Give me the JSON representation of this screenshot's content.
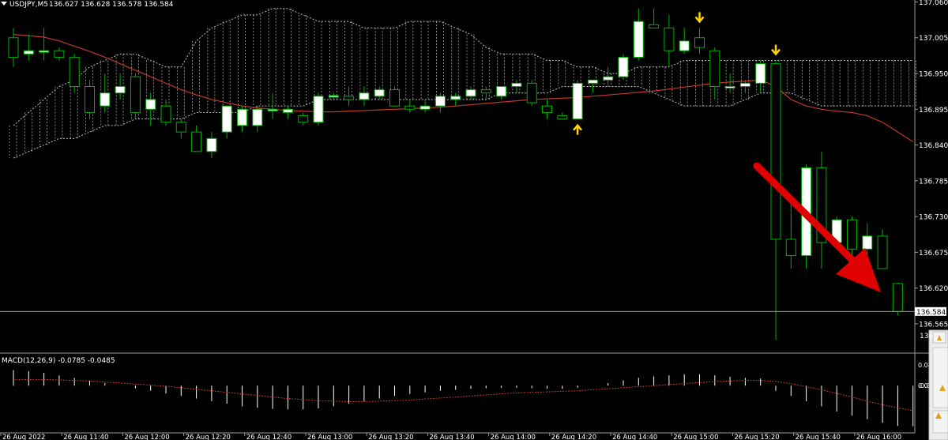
{
  "chart_data": [
    {
      "type": "candlestick",
      "symbol_label": "USDJPY,M5",
      "ohlc_label": "136.627 136.628 136.578 136.584",
      "price_axis_ticks": [
        "137.060",
        "137.005",
        "136.950",
        "136.895",
        "136.840",
        "136.785",
        "136.730",
        "136.675",
        "136.620",
        "136.565"
      ],
      "price_axis_partial_labels": [
        "136",
        "136"
      ],
      "current_price_label": "136.584",
      "current_price": 136.584,
      "ylim": [
        136.52,
        137.063
      ],
      "candles": [
        {
          "o": 137.005,
          "h": 137.02,
          "l": 136.96,
          "c": 136.975
        },
        {
          "o": 136.98,
          "h": 137.01,
          "l": 136.97,
          "c": 136.985
        },
        {
          "o": 136.985,
          "h": 137.02,
          "l": 136.97,
          "c": 136.985
        },
        {
          "o": 136.985,
          "h": 136.99,
          "l": 136.97,
          "c": 136.975
        },
        {
          "o": 136.975,
          "h": 136.98,
          "l": 136.92,
          "c": 136.93
        },
        {
          "o": 136.93,
          "h": 136.94,
          "l": 136.88,
          "c": 136.89
        },
        {
          "o": 136.9,
          "h": 136.95,
          "l": 136.89,
          "c": 136.92
        },
        {
          "o": 136.92,
          "h": 136.95,
          "l": 136.91,
          "c": 136.93
        },
        {
          "o": 136.945,
          "h": 136.95,
          "l": 136.88,
          "c": 136.89
        },
        {
          "o": 136.895,
          "h": 136.92,
          "l": 136.87,
          "c": 136.91
        },
        {
          "o": 136.9,
          "h": 136.91,
          "l": 136.87,
          "c": 136.875
        },
        {
          "o": 136.875,
          "h": 136.88,
          "l": 136.85,
          "c": 136.86
        },
        {
          "o": 136.86,
          "h": 136.87,
          "l": 136.83,
          "c": 136.83
        },
        {
          "o": 136.83,
          "h": 136.86,
          "l": 136.82,
          "c": 136.85
        },
        {
          "o": 136.86,
          "h": 136.9,
          "l": 136.85,
          "c": 136.9
        },
        {
          "o": 136.87,
          "h": 136.9,
          "l": 136.86,
          "c": 136.895
        },
        {
          "o": 136.87,
          "h": 136.9,
          "l": 136.86,
          "c": 136.895
        },
        {
          "o": 136.895,
          "h": 136.92,
          "l": 136.88,
          "c": 136.895
        },
        {
          "o": 136.89,
          "h": 136.9,
          "l": 136.88,
          "c": 136.895
        },
        {
          "o": 136.885,
          "h": 136.89,
          "l": 136.87,
          "c": 136.875
        },
        {
          "o": 136.875,
          "h": 136.92,
          "l": 136.87,
          "c": 136.915
        },
        {
          "o": 136.915,
          "h": 136.92,
          "l": 136.91,
          "c": 136.916
        },
        {
          "o": 136.915,
          "h": 136.93,
          "l": 136.9,
          "c": 136.91
        },
        {
          "o": 136.91,
          "h": 136.93,
          "l": 136.9,
          "c": 136.92
        },
        {
          "o": 136.915,
          "h": 136.93,
          "l": 136.91,
          "c": 136.925
        },
        {
          "o": 136.925,
          "h": 136.93,
          "l": 136.9,
          "c": 136.9
        },
        {
          "o": 136.9,
          "h": 136.91,
          "l": 136.89,
          "c": 136.895
        },
        {
          "o": 136.895,
          "h": 136.91,
          "l": 136.89,
          "c": 136.9
        },
        {
          "o": 136.9,
          "h": 136.92,
          "l": 136.89,
          "c": 136.915
        },
        {
          "o": 136.91,
          "h": 136.92,
          "l": 136.9,
          "c": 136.915
        },
        {
          "o": 136.915,
          "h": 136.93,
          "l": 136.91,
          "c": 136.925
        },
        {
          "o": 136.925,
          "h": 136.93,
          "l": 136.91,
          "c": 136.92
        },
        {
          "o": 136.915,
          "h": 136.93,
          "l": 136.91,
          "c": 136.93
        },
        {
          "o": 136.93,
          "h": 136.94,
          "l": 136.92,
          "c": 136.935
        },
        {
          "o": 136.935,
          "h": 136.94,
          "l": 136.9,
          "c": 136.905
        },
        {
          "o": 136.9,
          "h": 136.91,
          "l": 136.88,
          "c": 136.89
        },
        {
          "o": 136.885,
          "h": 136.89,
          "l": 136.88,
          "c": 136.88
        },
        {
          "o": 136.88,
          "h": 136.94,
          "l": 136.88,
          "c": 136.935
        },
        {
          "o": 136.935,
          "h": 136.94,
          "l": 136.92,
          "c": 136.94
        },
        {
          "o": 136.94,
          "h": 136.96,
          "l": 136.93,
          "c": 136.945
        },
        {
          "o": 136.945,
          "h": 136.98,
          "l": 136.94,
          "c": 136.975
        },
        {
          "o": 136.975,
          "h": 137.05,
          "l": 136.97,
          "c": 137.03
        },
        {
          "o": 137.025,
          "h": 137.05,
          "l": 137.02,
          "c": 137.02
        },
        {
          "o": 137.02,
          "h": 137.04,
          "l": 136.96,
          "c": 136.985
        },
        {
          "o": 136.985,
          "h": 137.02,
          "l": 136.98,
          "c": 137.0
        },
        {
          "o": 137.005,
          "h": 137.02,
          "l": 136.98,
          "c": 136.99
        },
        {
          "o": 136.985,
          "h": 136.99,
          "l": 136.91,
          "c": 136.93
        },
        {
          "o": 136.93,
          "h": 136.95,
          "l": 136.92,
          "c": 136.93
        },
        {
          "o": 136.93,
          "h": 136.94,
          "l": 136.92,
          "c": 136.935
        },
        {
          "o": 136.935,
          "h": 136.97,
          "l": 136.92,
          "c": 136.965
        },
        {
          "o": 136.965,
          "h": 136.97,
          "l": 136.54,
          "c": 136.695
        },
        {
          "o": 136.695,
          "h": 136.75,
          "l": 136.65,
          "c": 136.67
        },
        {
          "o": 136.67,
          "h": 136.81,
          "l": 136.65,
          "c": 136.805
        },
        {
          "o": 136.805,
          "h": 136.83,
          "l": 136.65,
          "c": 136.69
        },
        {
          "o": 136.69,
          "h": 136.73,
          "l": 136.68,
          "c": 136.725
        },
        {
          "o": 136.725,
          "h": 136.73,
          "l": 136.67,
          "c": 136.68
        },
        {
          "o": 136.68,
          "h": 136.72,
          "l": 136.66,
          "c": 136.7
        },
        {
          "o": 136.7,
          "h": 136.71,
          "l": 136.65,
          "c": 136.65
        },
        {
          "o": 136.627,
          "h": 136.628,
          "l": 136.578,
          "c": 136.584
        }
      ],
      "markers": [
        {
          "candle": 37,
          "direction": "up"
        },
        {
          "candle": 45,
          "direction": "down"
        },
        {
          "candle": 50,
          "direction": "down"
        }
      ],
      "time_labels": [
        {
          "candle": 0,
          "text": "26 Aug 2022"
        },
        {
          "candle": 4,
          "text": "26 Aug 11:40"
        },
        {
          "candle": 8,
          "text": "26 Aug 12:00"
        },
        {
          "candle": 12,
          "text": "26 Aug 12:20"
        },
        {
          "candle": 16,
          "text": "26 Aug 12:40"
        },
        {
          "candle": 20,
          "text": "26 Aug 13:00"
        },
        {
          "candle": 24,
          "text": "26 Aug 13:20"
        },
        {
          "candle": 28,
          "text": "26 Aug 13:40"
        },
        {
          "candle": 32,
          "text": "26 Aug 14:00"
        },
        {
          "candle": 36,
          "text": "26 Aug 14:20"
        },
        {
          "candle": 40,
          "text": "26 Aug 14:40"
        },
        {
          "candle": 44,
          "text": "26 Aug 15:00"
        },
        {
          "candle": 48,
          "text": "26 Aug 15:20"
        },
        {
          "candle": 52,
          "text": "26 Aug 15:40"
        },
        {
          "candle": 56,
          "text": "26 Aug 16:00"
        }
      ],
      "moving_average": [
        137.01,
        137.008,
        137.006,
        137.0,
        136.992,
        136.984,
        136.975,
        136.965,
        136.955,
        136.945,
        136.935,
        136.925,
        136.917,
        136.91,
        136.905,
        136.9,
        136.897,
        136.895,
        136.893,
        136.892,
        136.891,
        136.891,
        136.892,
        136.893,
        136.894,
        136.895,
        136.896,
        136.897,
        136.898,
        136.9,
        136.902,
        136.904,
        136.906,
        136.908,
        136.91,
        136.911,
        136.912,
        136.913,
        136.915,
        136.917,
        136.919,
        136.921,
        136.923,
        136.926,
        136.929,
        136.932,
        136.935,
        136.937,
        136.938,
        136.94,
        136.93,
        136.91,
        136.9,
        136.895,
        136.892,
        136.89,
        136.885,
        136.875,
        136.86,
        136.845
      ],
      "cloud_upper": [
        136.87,
        136.89,
        136.91,
        136.93,
        136.94,
        136.96,
        136.97,
        136.98,
        136.98,
        136.97,
        136.96,
        136.96,
        137.0,
        137.02,
        137.03,
        137.04,
        137.04,
        137.05,
        137.05,
        137.04,
        137.03,
        137.03,
        137.03,
        137.02,
        137.02,
        137.02,
        137.03,
        137.03,
        137.03,
        137.02,
        137.01,
        136.99,
        136.98,
        136.98,
        136.98,
        136.97,
        136.97,
        136.96,
        136.96,
        136.95,
        136.95,
        136.96,
        136.96,
        136.96,
        136.97,
        136.97,
        136.97,
        136.97,
        136.97,
        136.97,
        136.97,
        136.97,
        136.97,
        136.97,
        136.97,
        136.97,
        136.97,
        136.97,
        136.97,
        136.97
      ],
      "cloud_lower": [
        136.82,
        136.83,
        136.84,
        136.85,
        136.85,
        136.86,
        136.87,
        136.87,
        136.88,
        136.88,
        136.88,
        136.88,
        136.89,
        136.89,
        136.89,
        136.89,
        136.9,
        136.9,
        136.9,
        136.9,
        136.91,
        136.91,
        136.91,
        136.91,
        136.91,
        136.91,
        136.91,
        136.91,
        136.91,
        136.91,
        136.91,
        136.91,
        136.92,
        136.92,
        136.92,
        136.92,
        136.93,
        136.93,
        136.93,
        136.93,
        136.93,
        136.93,
        136.92,
        136.91,
        136.9,
        136.9,
        136.9,
        136.9,
        136.91,
        136.92,
        136.92,
        136.92,
        136.91,
        136.9,
        136.9,
        136.9,
        136.9,
        136.9,
        136.9,
        136.9
      ],
      "colors": {
        "background": "#000000",
        "up_candle": "#ffffff",
        "down_candle": "#000000",
        "wick": "#00b000",
        "moving_average": "#c0392b",
        "cloud": "#bfbfbf",
        "marker": "#ffd400",
        "arrow": "#e00000",
        "text": "#ffffff"
      }
    },
    {
      "type": "histogram",
      "label": "MACD(12,26,9) -0.0785 -0.0485",
      "axis_labels": [
        "0.04",
        "0.00",
        "-0.0"
      ],
      "ylim": [
        -0.09,
        0.06
      ],
      "histogram": [
        0.03,
        0.028,
        0.025,
        0.02,
        0.015,
        0.01,
        0.005,
        0.0,
        -0.005,
        -0.01,
        -0.015,
        -0.02,
        -0.025,
        -0.03,
        -0.035,
        -0.04,
        -0.043,
        -0.045,
        -0.046,
        -0.046,
        -0.044,
        -0.04,
        -0.035,
        -0.03,
        -0.025,
        -0.02,
        -0.016,
        -0.013,
        -0.01,
        -0.008,
        -0.006,
        -0.005,
        -0.004,
        -0.004,
        -0.005,
        -0.006,
        -0.006,
        -0.004,
        0.0,
        0.005,
        0.01,
        0.015,
        0.018,
        0.02,
        0.022,
        0.022,
        0.02,
        0.017,
        0.015,
        0.014,
        -0.01,
        -0.02,
        -0.03,
        -0.04,
        -0.05,
        -0.058,
        -0.065,
        -0.072,
        -0.078,
        -0.0785
      ],
      "signal": [
        0.012,
        0.012,
        0.012,
        0.011,
        0.01,
        0.009,
        0.007,
        0.005,
        0.003,
        0.001,
        -0.001,
        -0.004,
        -0.007,
        -0.01,
        -0.013,
        -0.016,
        -0.019,
        -0.022,
        -0.025,
        -0.027,
        -0.029,
        -0.03,
        -0.031,
        -0.031,
        -0.03,
        -0.029,
        -0.028,
        -0.026,
        -0.024,
        -0.022,
        -0.02,
        -0.018,
        -0.016,
        -0.014,
        -0.013,
        -0.012,
        -0.011,
        -0.01,
        -0.008,
        -0.006,
        -0.004,
        -0.002,
        0.0,
        0.002,
        0.004,
        0.006,
        0.008,
        0.009,
        0.01,
        0.01,
        0.008,
        0.004,
        -0.002,
        -0.008,
        -0.015,
        -0.022,
        -0.03,
        -0.037,
        -0.043,
        -0.0485
      ],
      "colors": {
        "histogram": "#ffffff",
        "signal": "#c0392b"
      }
    }
  ]
}
